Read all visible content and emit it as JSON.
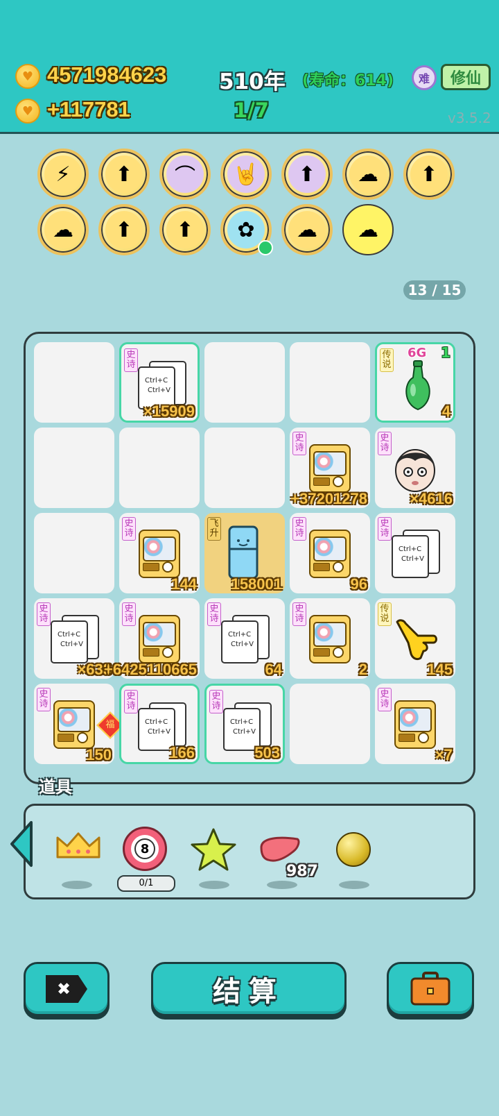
{
  "header": {
    "money_total": "4571984623",
    "money_rate": "+117781",
    "year": "510年",
    "lifespan": "(寿命：614)",
    "progress": "1/7",
    "difficulty_badge": "难",
    "mode_button": "修仙",
    "version": "v3.5.2",
    "accent_color": "#2ec7c3"
  },
  "badges_row1": [
    {
      "name": "lightning-icon",
      "glyph": "⚡",
      "style": "gold"
    },
    {
      "name": "bowl-arrow-icon",
      "glyph": "⬆",
      "style": "gold"
    },
    {
      "name": "skirt-icon",
      "glyph": "⌒",
      "style": "purple"
    },
    {
      "name": "rock-hand-icon",
      "glyph": "🤘",
      "style": "purple"
    },
    {
      "name": "bowl-arrow-icon",
      "glyph": "⬆",
      "style": "purple"
    },
    {
      "name": "mushroom-cloud-icon",
      "glyph": "☁",
      "style": "gold"
    },
    {
      "name": "bowl-arrow-icon",
      "glyph": "⬆",
      "style": "gold"
    }
  ],
  "badges_row2": [
    {
      "name": "mushroom-cloud-icon",
      "glyph": "☁",
      "style": "gold"
    },
    {
      "name": "bowl-arrow-icon",
      "glyph": "⬆",
      "style": "gold"
    },
    {
      "name": "bowl-arrow-icon",
      "glyph": "⬆",
      "style": "gold"
    },
    {
      "name": "flower-pot-icon",
      "glyph": "✿",
      "style": "blue"
    },
    {
      "name": "mushroom-cloud-icon",
      "glyph": "☁",
      "style": "gold"
    },
    {
      "name": "mushroom-cloud-icon",
      "glyph": "☁",
      "style": "plain"
    }
  ],
  "page_indicator": "13 / 15",
  "board": [
    {
      "type": "empty"
    },
    {
      "type": "copy",
      "tag": "史诗",
      "count": "×15909",
      "highlight": true
    },
    {
      "type": "empty"
    },
    {
      "type": "empty"
    },
    {
      "type": "bottle",
      "tag": "传说",
      "count": "4",
      "top_label": "6G",
      "top_right": "1",
      "highlight": true
    },
    {
      "type": "empty"
    },
    {
      "type": "empty"
    },
    {
      "type": "empty"
    },
    {
      "type": "vending",
      "tag": "史诗",
      "count": "+37201278"
    },
    {
      "type": "face",
      "tag": "史诗",
      "count": "×4616"
    },
    {
      "type": "empty"
    },
    {
      "type": "vending",
      "tag": "史诗",
      "count": "144"
    },
    {
      "type": "fridge",
      "tag": "飞升",
      "count": "158001",
      "gold": true
    },
    {
      "type": "vending",
      "tag": "史诗",
      "count": "96"
    },
    {
      "type": "copy",
      "tag": "史诗",
      "count": ""
    },
    {
      "type": "copy",
      "tag": "史诗",
      "count": "×638"
    },
    {
      "type": "vending",
      "tag": "史诗",
      "count": "+6425110665"
    },
    {
      "type": "copy",
      "tag": "史诗",
      "count": "64"
    },
    {
      "type": "vending",
      "tag": "史诗",
      "count": "2"
    },
    {
      "type": "pointer",
      "tag": "传说",
      "count": "145"
    },
    {
      "type": "vending",
      "tag": "史诗",
      "count": "150",
      "fu": "福"
    },
    {
      "type": "copy",
      "tag": "史诗",
      "count": "166",
      "highlight": true
    },
    {
      "type": "copy",
      "tag": "史诗",
      "count": "503",
      "highlight": true
    },
    {
      "type": "empty"
    },
    {
      "type": "vending",
      "tag": "史诗",
      "count": "×7"
    }
  ],
  "copy_card": {
    "line1": "Ctrl+C",
    "line2": "Ctrl+V"
  },
  "props": {
    "title": "道具",
    "target_number": "8",
    "target_uses": "0/1",
    "liver_count": "987"
  },
  "buttons": {
    "delete_icon": "✖",
    "settle": "结算"
  }
}
